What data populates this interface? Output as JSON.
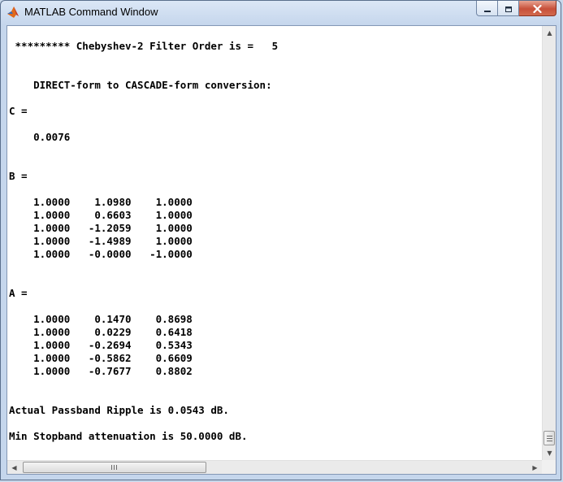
{
  "window": {
    "title": "MATLAB Command Window"
  },
  "icons": {
    "app": "matlab-logo-icon",
    "minimize": "minimize-icon",
    "maximize": "maximize-icon",
    "close": "close-icon"
  },
  "output": {
    "lines": [
      " ********* Chebyshev-2 Filter Order is =   5",
      "    DIRECT-form to CASCADE-form conversion:",
      "C =",
      "    0.0076",
      "B =",
      "    1.0000    1.0980    1.0000",
      "    1.0000    0.6603    1.0000",
      "    1.0000   -1.2059    1.0000",
      "    1.0000   -1.4989    1.0000",
      "    1.0000   -0.0000   -1.0000",
      "A =",
      "    1.0000    0.1470    0.8698",
      "    1.0000    0.0229    0.6418",
      "    1.0000   -0.2694    0.5343",
      "    1.0000   -0.5862    0.6609",
      "    1.0000   -0.7677    0.8802",
      "Actual Passband Ripple is 0.0543 dB.",
      "Min Stopband attenuation is 50.0000 dB."
    ]
  },
  "scrollbars": {
    "vertical_position": 1.0,
    "horizontal_position": 0.0
  }
}
